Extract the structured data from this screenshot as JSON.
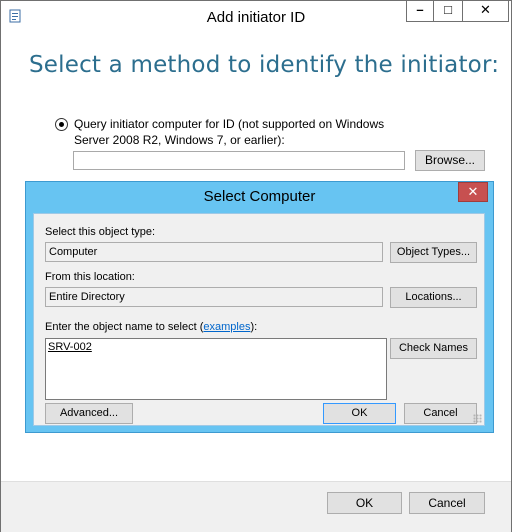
{
  "outer_window": {
    "title": "Add initiator ID",
    "heading": "Select a method to identify the initiator:",
    "radio_label": "Query initiator computer for ID (not supported on Windows Server 2008 R2, Windows 7, or earlier):",
    "radio_selected": true,
    "id_input_value": "",
    "browse_label": "Browse...",
    "ok_label": "OK",
    "cancel_label": "Cancel",
    "caption": {
      "minimize": "–",
      "maximize": "□",
      "close": "✕"
    }
  },
  "select_computer": {
    "title": "Select Computer",
    "close_glyph": "✕",
    "object_type_label": "Select this object type:",
    "object_type_value": "Computer",
    "object_types_button": "Object Types...",
    "location_label": "From this location:",
    "location_value": "Entire Directory",
    "locations_button": "Locations...",
    "names_label_prefix": "Enter the object name to select (",
    "names_label_link": "examples",
    "names_label_suffix": "):",
    "names_value": "SRV-002",
    "check_names_button": "Check Names",
    "advanced_button": "Advanced...",
    "ok_button": "OK",
    "cancel_button": "Cancel"
  },
  "colors": {
    "heading": "#2c6e8e",
    "inner_frame": "#67c4f2",
    "inner_close": "#c75050"
  }
}
